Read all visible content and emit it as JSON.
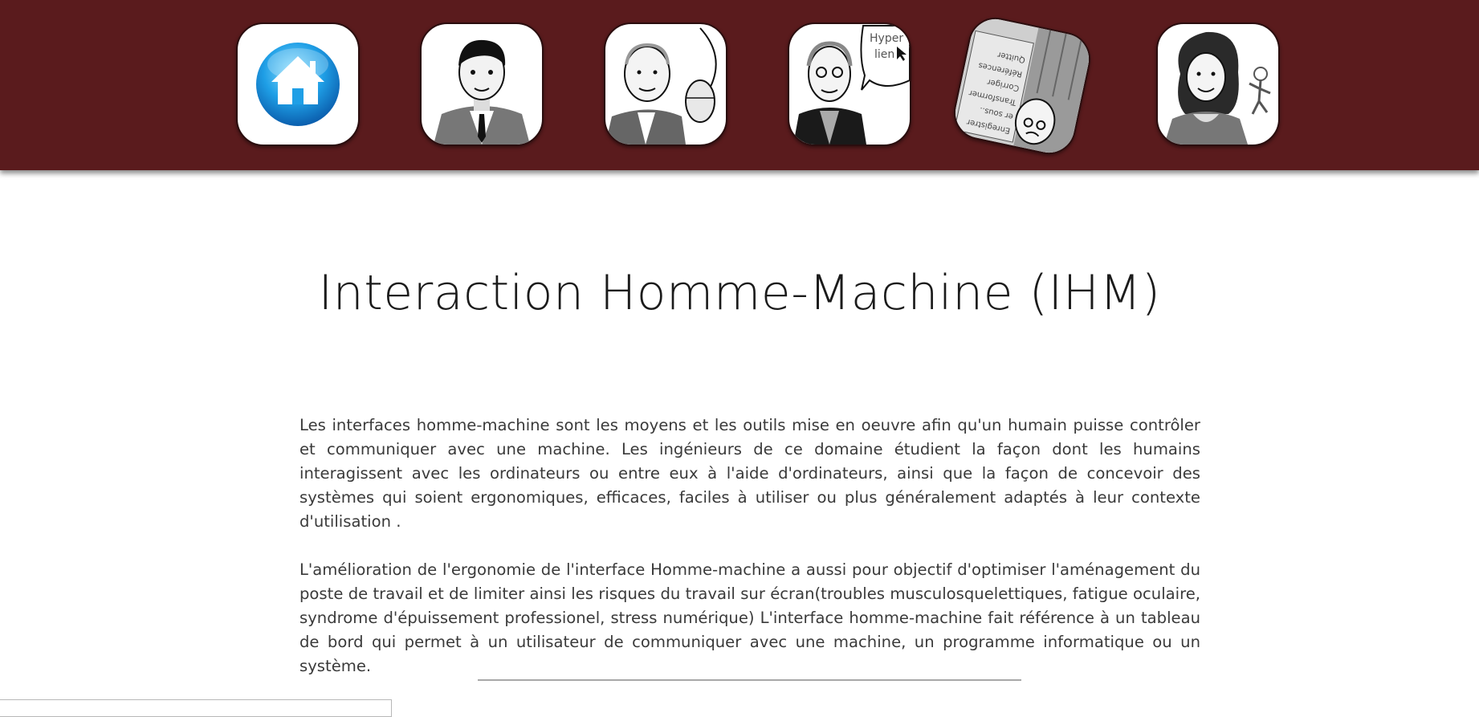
{
  "nav": {
    "items": [
      {
        "id": "home",
        "icon": "home-icon",
        "accent": "#2aa7e8"
      },
      {
        "id": "portrait-1",
        "icon": "man-portrait-icon"
      },
      {
        "id": "portrait-2",
        "icon": "man-with-mouse-icon"
      },
      {
        "id": "portrait-3",
        "icon": "man-hyperlink-icon",
        "bubble_text": "Hyper lien"
      },
      {
        "id": "portrait-4",
        "icon": "man-menu-icon",
        "menu_lines": [
          "Enregistrer",
          "er sous..",
          "Transformer",
          "Corriger",
          "Références",
          "Quitter"
        ]
      },
      {
        "id": "portrait-5",
        "icon": "woman-portrait-icon"
      }
    ],
    "bar_color": "#5a1b1d"
  },
  "page": {
    "title": "Interaction Homme-Machine (IHM)",
    "paragraphs": [
      "Les interfaces homme-machine sont les moyens et les outils mise en oeuvre afin qu'un humain puisse contrôler et communiquer avec une machine. Les ingénieurs de ce domaine étudient la façon dont les humains interagissent avec les ordinateurs ou entre eux à l'aide d'ordinateurs, ainsi que la façon de concevoir des systèmes qui soient ergonomiques, efficaces, faciles à utiliser ou plus généralement adaptés à leur contexte d'utilisation .",
      "L'amélioration de l'ergonomie de l'interface Homme-machine a aussi pour objectif d'optimiser l'aménagement du poste de travail et de limiter ainsi les risques du travail sur écran(troubles musculosquelettiques, fatigue oculaire, syndrome d'épuissement professionel, stress numérique) L'interface homme-machine fait référence à un tableau de bord qui permet à un utilisateur de communiquer avec une machine, un programme informatique ou un système."
    ]
  }
}
